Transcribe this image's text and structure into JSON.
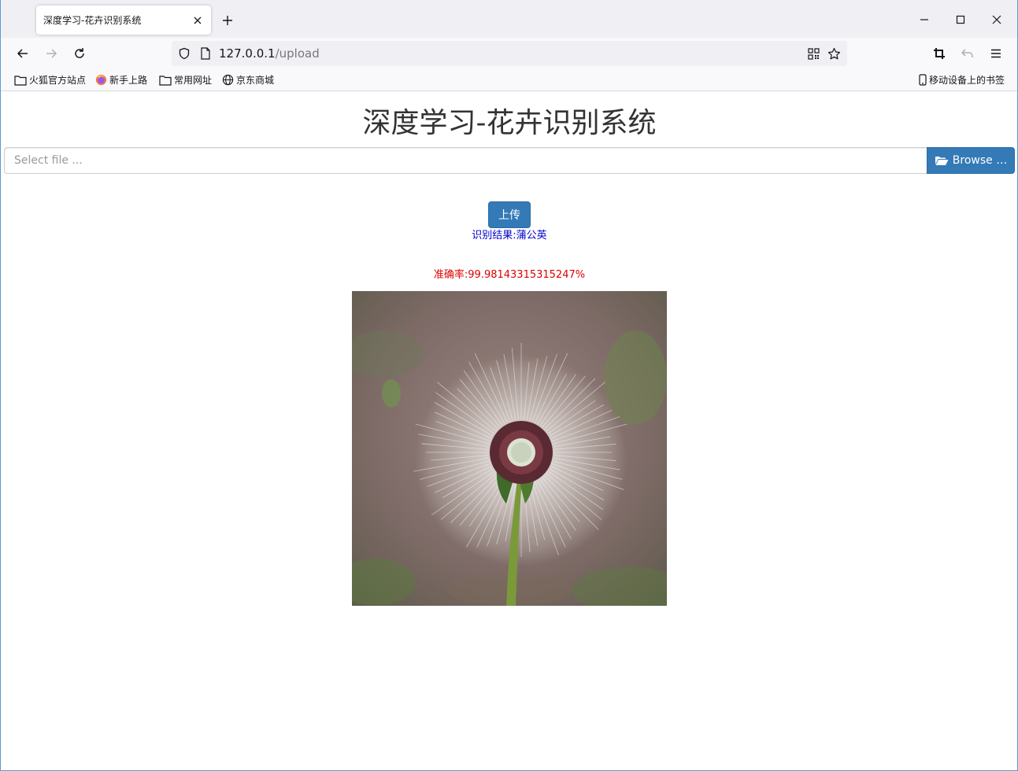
{
  "browser": {
    "tab_title": "深度学习-花卉识别系统",
    "url_host": "127.0.0.1",
    "url_path": "/upload",
    "bookmarks": [
      {
        "label": "火狐官方站点",
        "icon": "folder-icon"
      },
      {
        "label": "新手上路",
        "icon": "firefox-icon"
      },
      {
        "label": "常用网址",
        "icon": "folder-icon"
      },
      {
        "label": "京东商城",
        "icon": "globe-icon"
      }
    ],
    "mobile_bookmarks": "移动设备上的书签"
  },
  "page": {
    "title": "深度学习-花卉识别系统",
    "file_placeholder": "Select file ...",
    "browse_label": "Browse …",
    "upload_label": "上传",
    "result_text": "识别结果:蒲公英",
    "accuracy_text": "准确率:99.98143315315247%"
  },
  "colors": {
    "primary": "#337ab7",
    "result": "#0000cc",
    "accuracy": "#dd0000"
  }
}
